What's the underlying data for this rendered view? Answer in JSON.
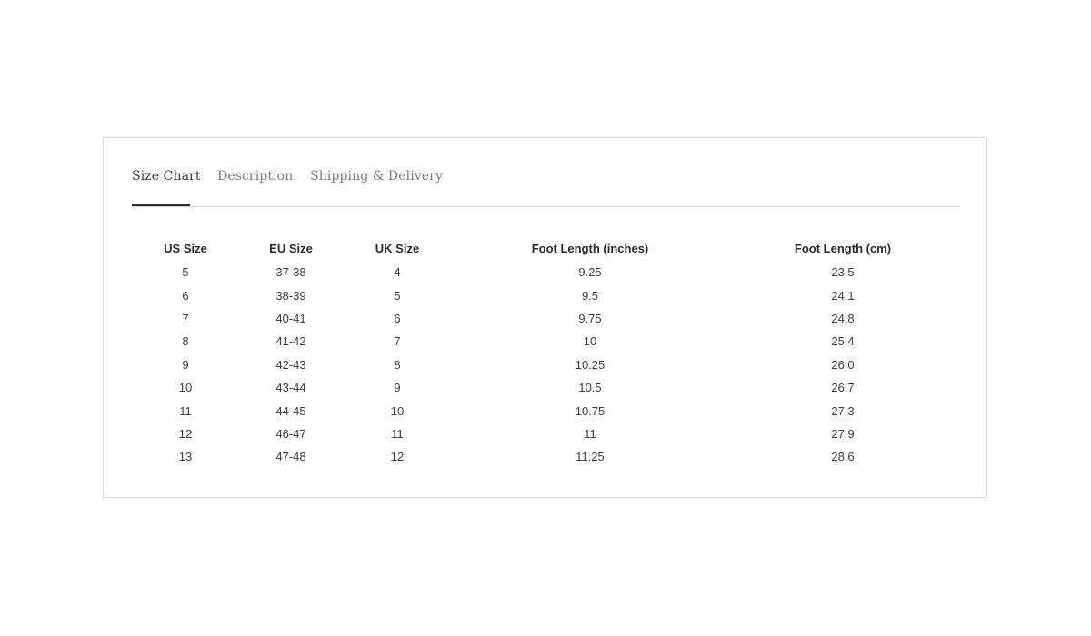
{
  "tabs": [
    {
      "label": "Size Chart",
      "active": true
    },
    {
      "label": "Description",
      "active": false
    },
    {
      "label": "Shipping & Delivery",
      "active": false
    }
  ],
  "table": {
    "headers": [
      "US Size",
      "EU Size",
      "UK Size",
      "Foot Length (inches)",
      "Foot Length (cm)"
    ],
    "rows": [
      [
        "5",
        "37-38",
        "4",
        "9.25",
        "23.5"
      ],
      [
        "6",
        "38-39",
        "5",
        "9.5",
        "24.1"
      ],
      [
        "7",
        "40-41",
        "6",
        "9.75",
        "24.8"
      ],
      [
        "8",
        "41-42",
        "7",
        "10",
        "25.4"
      ],
      [
        "9",
        "42-43",
        "8",
        "10.25",
        "26.0"
      ],
      [
        "10",
        "43-44",
        "9",
        "10.5",
        "26.7"
      ],
      [
        "11",
        "44-45",
        "10",
        "10.75",
        "27.3"
      ],
      [
        "12",
        "46-47",
        "11",
        "11",
        "27.9"
      ],
      [
        "13",
        "47-48",
        "12",
        "11.25",
        "28.6"
      ]
    ]
  }
}
